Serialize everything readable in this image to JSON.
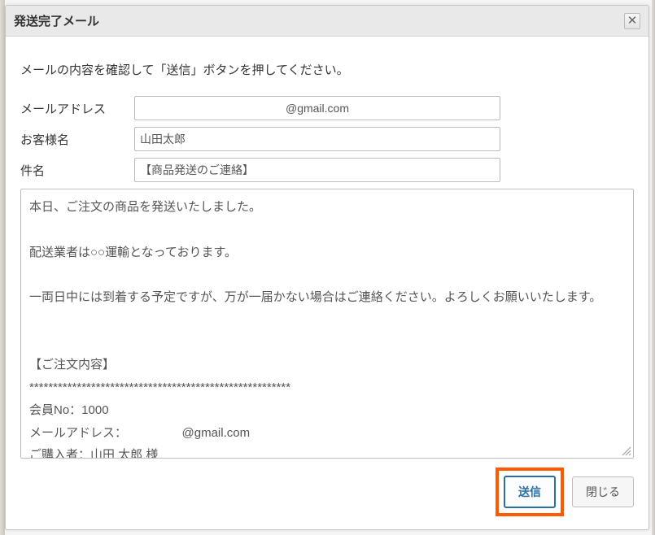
{
  "dialog": {
    "title": "発送完了メール",
    "close_symbol": "✕"
  },
  "instruction": "メールの内容を確認して「送信」ボタンを押してください。",
  "fields": {
    "email_label": "メールアドレス",
    "email_value": "@gmail.com",
    "customer_label": "お客様名",
    "customer_value": "山田太郎",
    "subject_label": "件名",
    "subject_value": "【商品発送のご連絡】"
  },
  "body_text": "本日、ご注文の商品を発送いたしました。\n\n配送業者は○○運輸となっております。\n\n一両日中には到着する予定ですが、万が一届かない場合はご連絡ください。よろしくお願いいたします。\n\n\n【ご注文内容】\n*******************************************************\n会員No：1000\nメールアドレス：　　　　　@gmail.com\nご購入者：山田 太郎 様\nフリガナ：ヤマダ タロウ\n郵便番号：",
  "footer": {
    "submit_label": "送信",
    "close_label": "閉じる"
  }
}
